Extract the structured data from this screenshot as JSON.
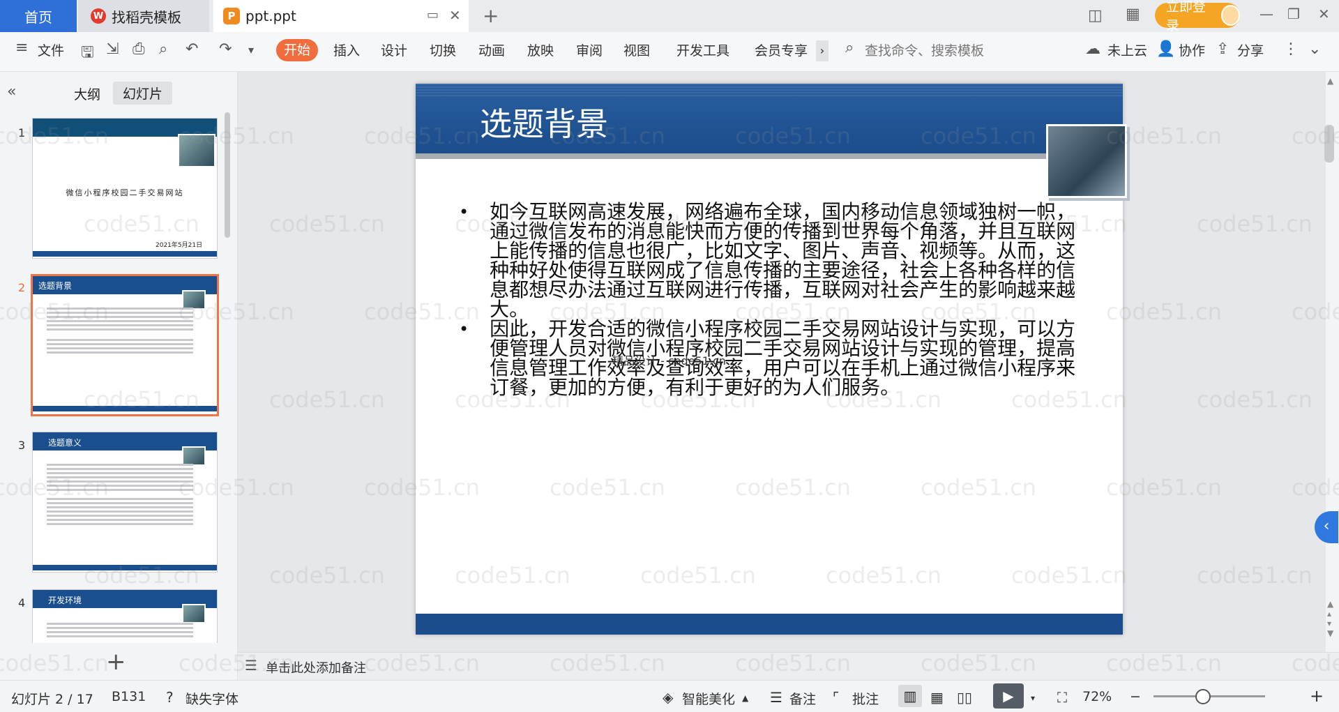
{
  "tabs": {
    "home": "首页",
    "zhaodaoke": "找稻壳模板",
    "doc": "ppt.ppt",
    "login": "立即登录"
  },
  "ribbon": {
    "file": "文件",
    "menus": [
      "开始",
      "插入",
      "设计",
      "切换",
      "动画",
      "放映",
      "审阅",
      "视图",
      "开发工具",
      "会员专享"
    ],
    "search_placeholder": "查找命令、搜索模板",
    "cloud": "未上云",
    "collab": "协作",
    "share": "分享"
  },
  "panel": {
    "outline_tab": "大纲",
    "slides_tab": "幻灯片",
    "thumbs": [
      {
        "num": "1",
        "title": "微信小程序校园二手交易网站",
        "date": "2021年5月21日"
      },
      {
        "num": "2",
        "title": "选题背景"
      },
      {
        "num": "3",
        "title": "选题意义"
      },
      {
        "num": "4",
        "title": "开发环境"
      }
    ]
  },
  "slide": {
    "title": "选题背景",
    "bullets": [
      "如今互联网高速发展，网络遍布全球，国内移动信息领域独树一帜，通过微信发布的消息能快而方便的传播到世界每个角落，并且互联网上能传播的信息也很广，比如文字、图片、声音、视频等。从而，这种种好处使得互联网成了信息传播的主要途径，社会上各种各样的信息都想尽办法通过互联网进行传播，互联网对社会产生的影响越来越大。",
      "因此，开发合适的微信小程序校园二手交易网站设计与实现，可以方便管理人员对微信小程序校园二手交易网站设计与实现的管理，提高信息管理工作效率及查询效率，用户可以在手机上通过微信小程序来订餐，更加的方便，有利于更好的为人们服务。"
    ],
    "overlay_text": "精品设计 - code51.cn"
  },
  "notes": {
    "placeholder": "单击此处添加备注"
  },
  "status": {
    "slide_counter": "幻灯片 2 / 17",
    "code": "B131",
    "missing_font": "缺失字体",
    "beautify": "智能美化",
    "notes": "备注",
    "comment": "批注",
    "zoom": "72%"
  },
  "watermark": "code51.cn"
}
